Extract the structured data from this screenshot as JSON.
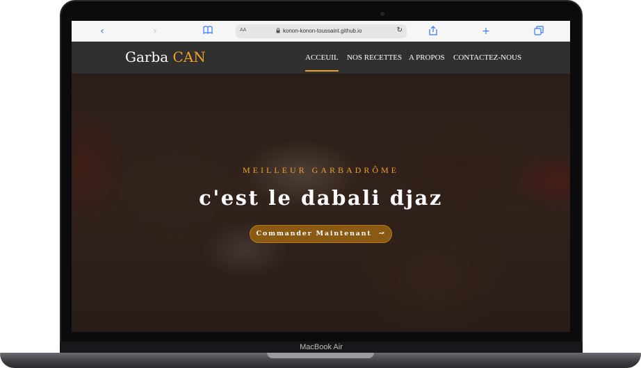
{
  "device": {
    "model_label": "MacBook Air"
  },
  "browser": {
    "reader_label": "AA",
    "url": "konon-konon-toussaint.github.io",
    "icons": [
      "back-icon",
      "forward-icon",
      "bookmarks-icon",
      "lock-icon",
      "reload-icon",
      "share-icon",
      "new-tab-icon",
      "tabs-icon"
    ]
  },
  "site": {
    "brand_part1": "Garba",
    "brand_part2": "CAN",
    "nav": [
      {
        "label": "ACCEUIL",
        "active": true
      },
      {
        "label": "NOS RECETTES",
        "active": false
      },
      {
        "label": "A PROPOS",
        "active": false
      },
      {
        "label": "CONTACTEZ-NOUS",
        "active": false
      }
    ],
    "hero": {
      "subtitle": "MEILLEUR GARBADRÔME",
      "headline": "c'est le dabali djaz",
      "cta_label": "Commander Maintenant",
      "cta_icon": "swirl-arrow-icon"
    }
  },
  "colors": {
    "accent": "#f2a025",
    "navbar": "#303030",
    "cta": "#8a5a14"
  }
}
